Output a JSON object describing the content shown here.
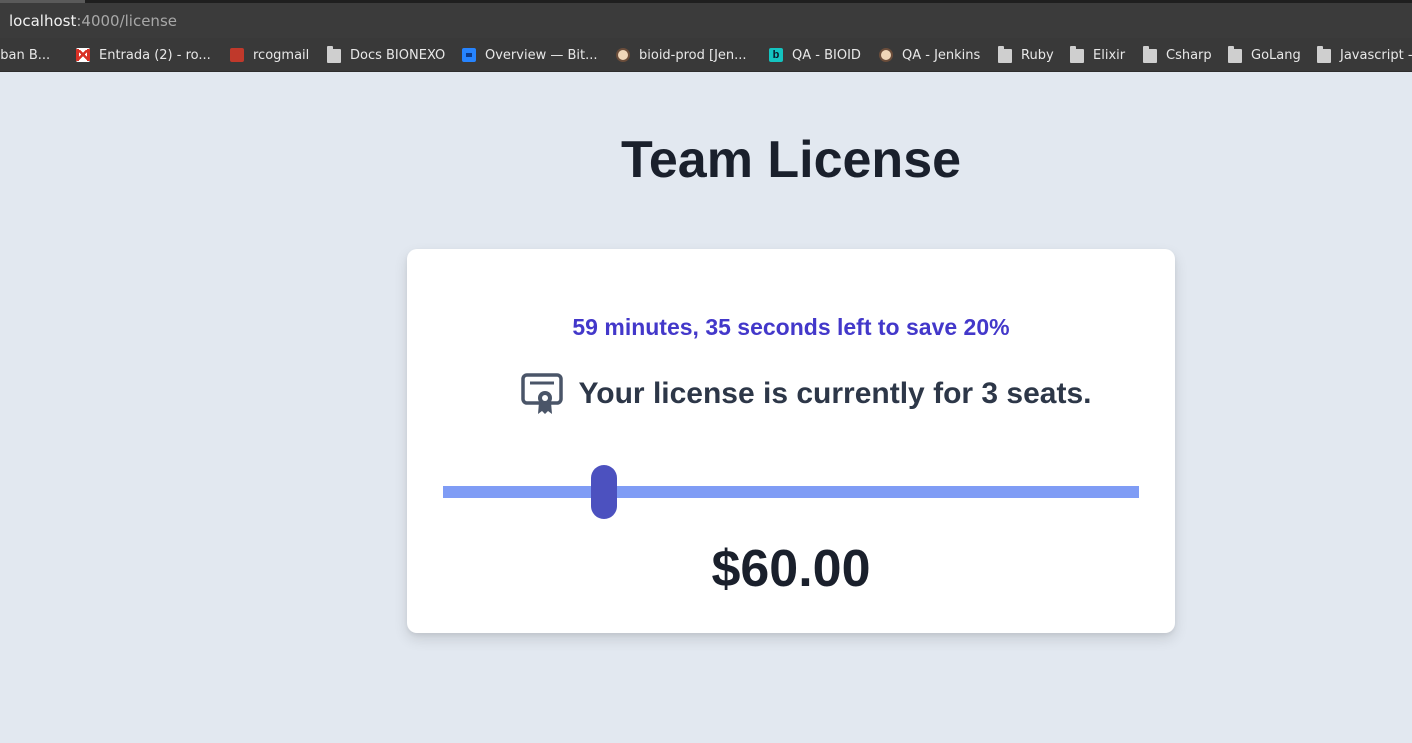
{
  "browser": {
    "url_host": "localhost",
    "url_rest": ":4000/license",
    "bookmarks": [
      {
        "label": "nban B...",
        "icon": "none"
      },
      {
        "label": "Entrada (2) - ro...",
        "icon": "gmail-icon"
      },
      {
        "label": "rcogmail",
        "icon": "rcogmail-icon"
      },
      {
        "label": "Docs BIONEXO",
        "icon": "folder-icon"
      },
      {
        "label": "Overview — Bit...",
        "icon": "bitbucket-icon"
      },
      {
        "label": "bioid-prod [Jen...",
        "icon": "jenkins-icon"
      },
      {
        "label": "QA - BIOID",
        "icon": "bioid-icon"
      },
      {
        "label": "QA - Jenkins",
        "icon": "jenkins-icon"
      },
      {
        "label": "Ruby",
        "icon": "folder-icon"
      },
      {
        "label": "Elixir",
        "icon": "folder-icon"
      },
      {
        "label": "Csharp",
        "icon": "folder-icon"
      },
      {
        "label": "GoLang",
        "icon": "folder-icon"
      },
      {
        "label": "Javascript -",
        "icon": "folder-icon"
      }
    ]
  },
  "page": {
    "title": "Team License",
    "countdown": "59 minutes, 35 seconds left to save 20%",
    "seats_text": "Your license is currently for 3 seats.",
    "slider_value_fraction": 0.232,
    "price": "$60.00",
    "icon": "certificate-icon",
    "colors": {
      "background": "#e2e8f0",
      "countdown": "#4338ca",
      "track": "#7f9cf5",
      "thumb": "#4c51bf",
      "heading": "#1a202c"
    }
  }
}
